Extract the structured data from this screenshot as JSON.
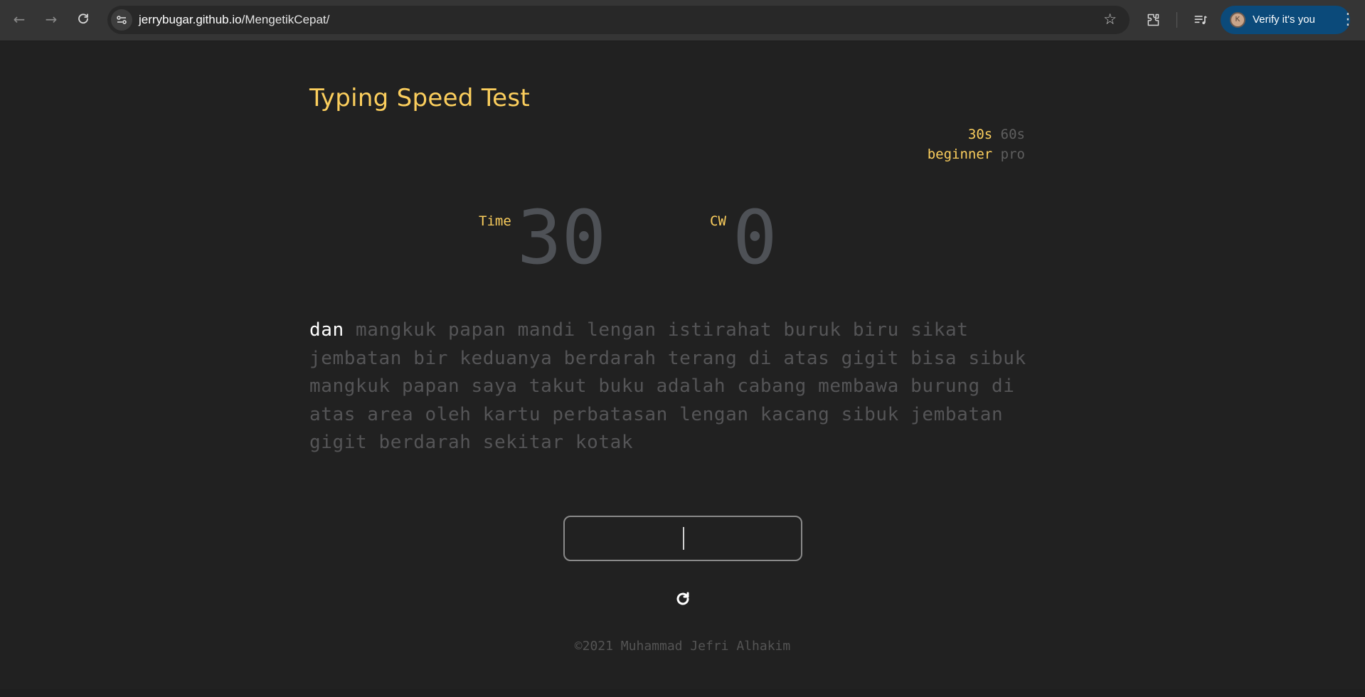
{
  "browser": {
    "url_host": "jerrybugar.github.io",
    "url_path": "/MengetikCepat/",
    "profile_initial": "K",
    "profile_button": "Verify it's you",
    "icons": [
      "back-arrow-icon",
      "forward-arrow-icon",
      "reload-icon",
      "site-settings-icon",
      "bookmark-star-icon",
      "extensions-icon",
      "reading-list-icon",
      "more-menu-icon"
    ]
  },
  "page": {
    "title": "Typing Speed Test",
    "options": {
      "durations": [
        {
          "label": "30s",
          "selected": true
        },
        {
          "label": "60s",
          "selected": false
        }
      ],
      "levels": [
        {
          "label": "beginner",
          "selected": true
        },
        {
          "label": "pro",
          "selected": false
        }
      ]
    },
    "stats": {
      "time_label": "Time",
      "time_value": "30",
      "cw_label": "CW",
      "cw_value": "0"
    },
    "words": {
      "current": "dan",
      "remaining": "mangkuk papan mandi lengan istirahat buruk biru sikat jembatan bir keduanya berdarah terang di atas gigit bisa sibuk mangkuk papan saya takut buku adalah cabang membawa burung di atas area oleh kartu perbatasan lengan kacang sibuk jembatan gigit berdarah sekitar kotak"
    },
    "input": {
      "value": "",
      "placeholder": ""
    },
    "footer": "©2021 Muhammad Jefri Alhakim",
    "colors": {
      "accent": "#fbce5d",
      "background": "#212121",
      "muted": "#555557"
    }
  }
}
